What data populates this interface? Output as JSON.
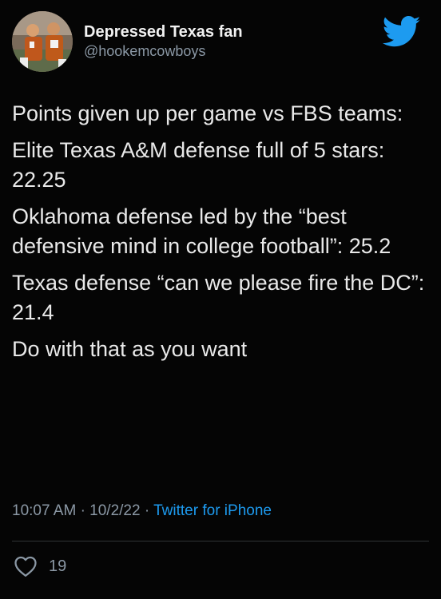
{
  "user": {
    "display_name": "Depressed Texas fan",
    "handle": "@hookemcowboys"
  },
  "tweet": {
    "paragraphs": [
      "Points given up per game vs FBS teams:",
      "Elite Texas A&M defense full of 5 stars: 22.25",
      "Oklahoma defense led by the “best defensive mind in college football”: 25.2",
      "Texas defense “can we please fire the DC”: 21.4",
      "Do with that as you want"
    ],
    "time": "10:07 AM",
    "date": "10/2/22",
    "separator": "·",
    "source": "Twitter for iPhone"
  },
  "engagement": {
    "likes": "19"
  },
  "icons": {
    "logo": "twitter-bird-icon",
    "like": "heart-icon"
  },
  "colors": {
    "background": "#050505",
    "text": "#e9e9e9",
    "muted": "#8b98a5",
    "accent": "#1d9bf0"
  }
}
